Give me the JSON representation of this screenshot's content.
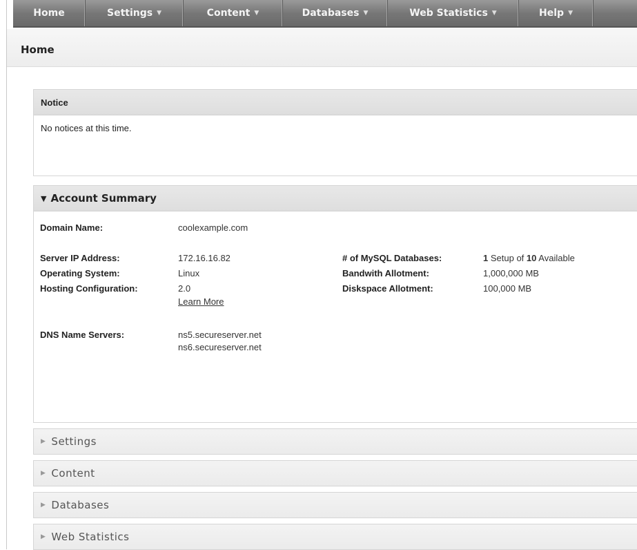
{
  "nav": {
    "items": [
      {
        "label": "Home",
        "dropdown": false
      },
      {
        "label": "Settings",
        "dropdown": true
      },
      {
        "label": "Content",
        "dropdown": true
      },
      {
        "label": "Databases",
        "dropdown": true
      },
      {
        "label": "Web Statistics",
        "dropdown": true
      },
      {
        "label": "Help",
        "dropdown": true
      }
    ],
    "dropdown_glyph": "▼"
  },
  "page": {
    "title": "Home"
  },
  "notice": {
    "title": "Notice",
    "message": "No notices at this time."
  },
  "summary": {
    "title": "Account Summary",
    "expanded_glyph": "▼",
    "domain_label": "Domain Name:",
    "domain_value": "coolexample.com",
    "ip_label": "Server IP Address:",
    "ip_value": "172.16.16.82",
    "os_label": "Operating System:",
    "os_value": "Linux",
    "config_label": "Hosting Configuration:",
    "config_value": "2.0",
    "learn_more": "Learn More",
    "dns_label": "DNS Name Servers:",
    "dns_values": [
      "ns5.secureserver.net",
      "ns6.secureserver.net"
    ],
    "mysql_label": "# of MySQL Databases:",
    "mysql_used": "1",
    "mysql_mid": "Setup of",
    "mysql_total": "10",
    "mysql_tail": "Available",
    "bandwidth_label": "Bandwith Allotment:",
    "bandwidth_value": "1,000,000 MB",
    "disk_label": "Diskspace Allotment:",
    "disk_value": "100,000 MB"
  },
  "sections": [
    {
      "label": "Settings"
    },
    {
      "label": "Content"
    },
    {
      "label": "Databases"
    },
    {
      "label": "Web Statistics"
    }
  ],
  "collapsed_glyph": "▶",
  "colors": {
    "nav_bg": "#777777",
    "panel_head": "#e2e2e2",
    "text": "#222222"
  }
}
